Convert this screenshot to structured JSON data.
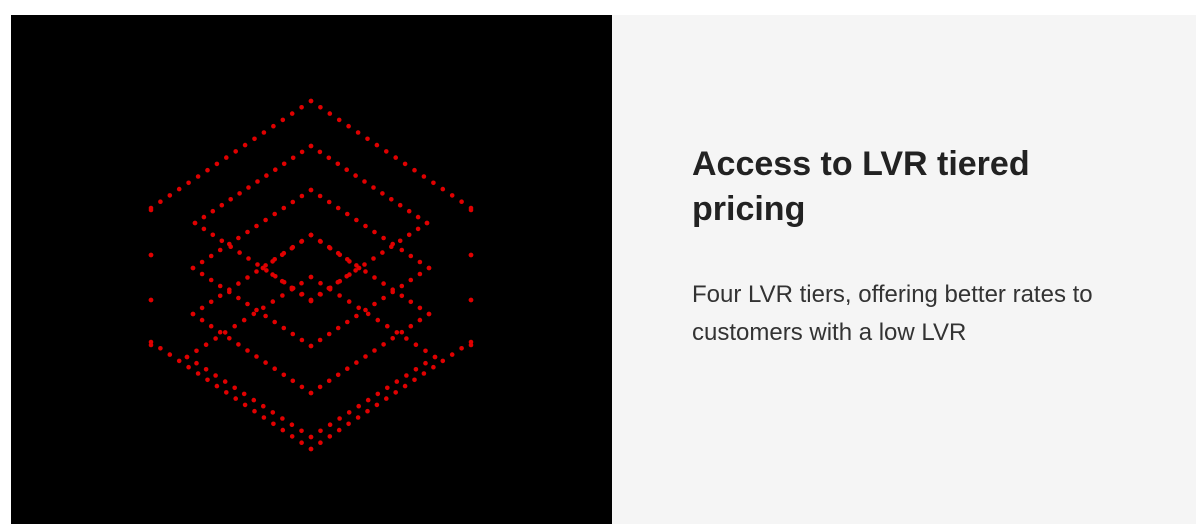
{
  "feature": {
    "title": "Access to LVR tiered pricing",
    "description": "Four LVR tiers, offering better rates to customers with a low LVR"
  },
  "illustration": {
    "icon": "stacked-tiers-icon",
    "background_color": "#000000",
    "dot_color": "#e00000",
    "tier_count": 4
  },
  "theme": {
    "panel_background": "#f5f5f5",
    "title_color": "#222222",
    "text_color": "#333333"
  }
}
